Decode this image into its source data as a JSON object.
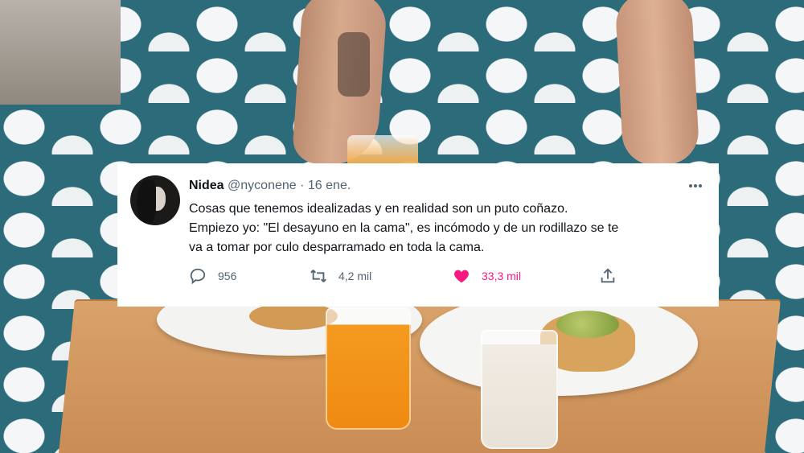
{
  "tweet": {
    "display_name": "Nidea",
    "handle": "@nyconene",
    "separator": "·",
    "date": "16 ene.",
    "text_lines": [
      "Cosas que tenemos idealizadas y en realidad son un puto coñazo.",
      "Empiezo yo: \"El desayuno en la cama\", es incómodo y de un rodillazo se te",
      "va a tomar por culo desparramado en toda la cama."
    ],
    "replies": "956",
    "retweets": "4,2 mil",
    "likes": "33,3 mil"
  },
  "colors": {
    "text": "#0f1419",
    "muted": "#536471",
    "like": "#f91880"
  }
}
